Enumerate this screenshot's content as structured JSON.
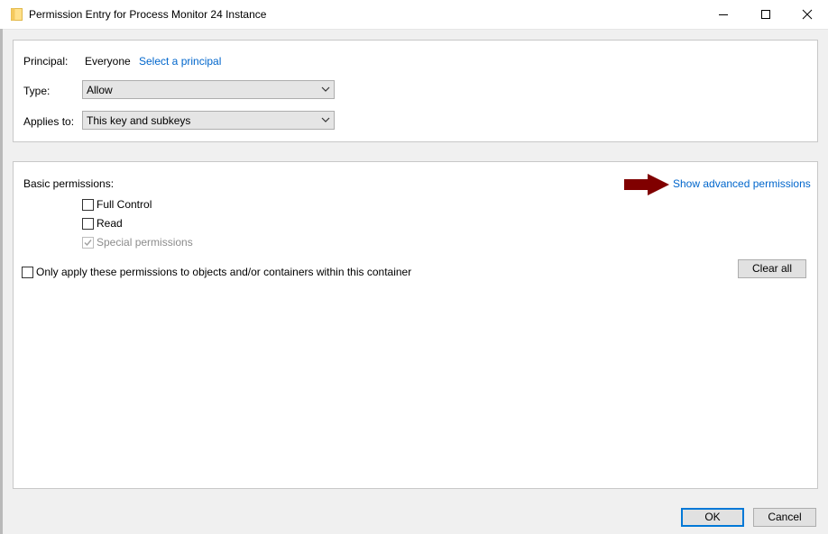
{
  "window": {
    "title": "Permission Entry for Process Monitor 24 Instance",
    "icon": "folder-icon",
    "minimize_icon": "minimize-icon",
    "maximize_icon": "maximize-icon",
    "close_icon": "close-icon"
  },
  "principal": {
    "label": "Principal:",
    "value": "Everyone",
    "select_link": "Select a principal"
  },
  "type": {
    "label": "Type:",
    "selected": "Allow"
  },
  "applies_to": {
    "label": "Applies to:",
    "selected": "This key and subkeys"
  },
  "permissions": {
    "label": "Basic permissions:",
    "advanced_link": "Show advanced permissions",
    "arrow_color": "#800000",
    "items": [
      {
        "label": "Full Control",
        "checked": false,
        "enabled": true
      },
      {
        "label": "Read",
        "checked": false,
        "enabled": true
      },
      {
        "label": "Special permissions",
        "checked": true,
        "enabled": false
      }
    ],
    "only_apply_label": "Only apply these permissions to objects and/or containers within this container",
    "only_apply_checked": false,
    "clear_all": "Clear all"
  },
  "footer": {
    "ok": "OK",
    "cancel": "Cancel"
  }
}
